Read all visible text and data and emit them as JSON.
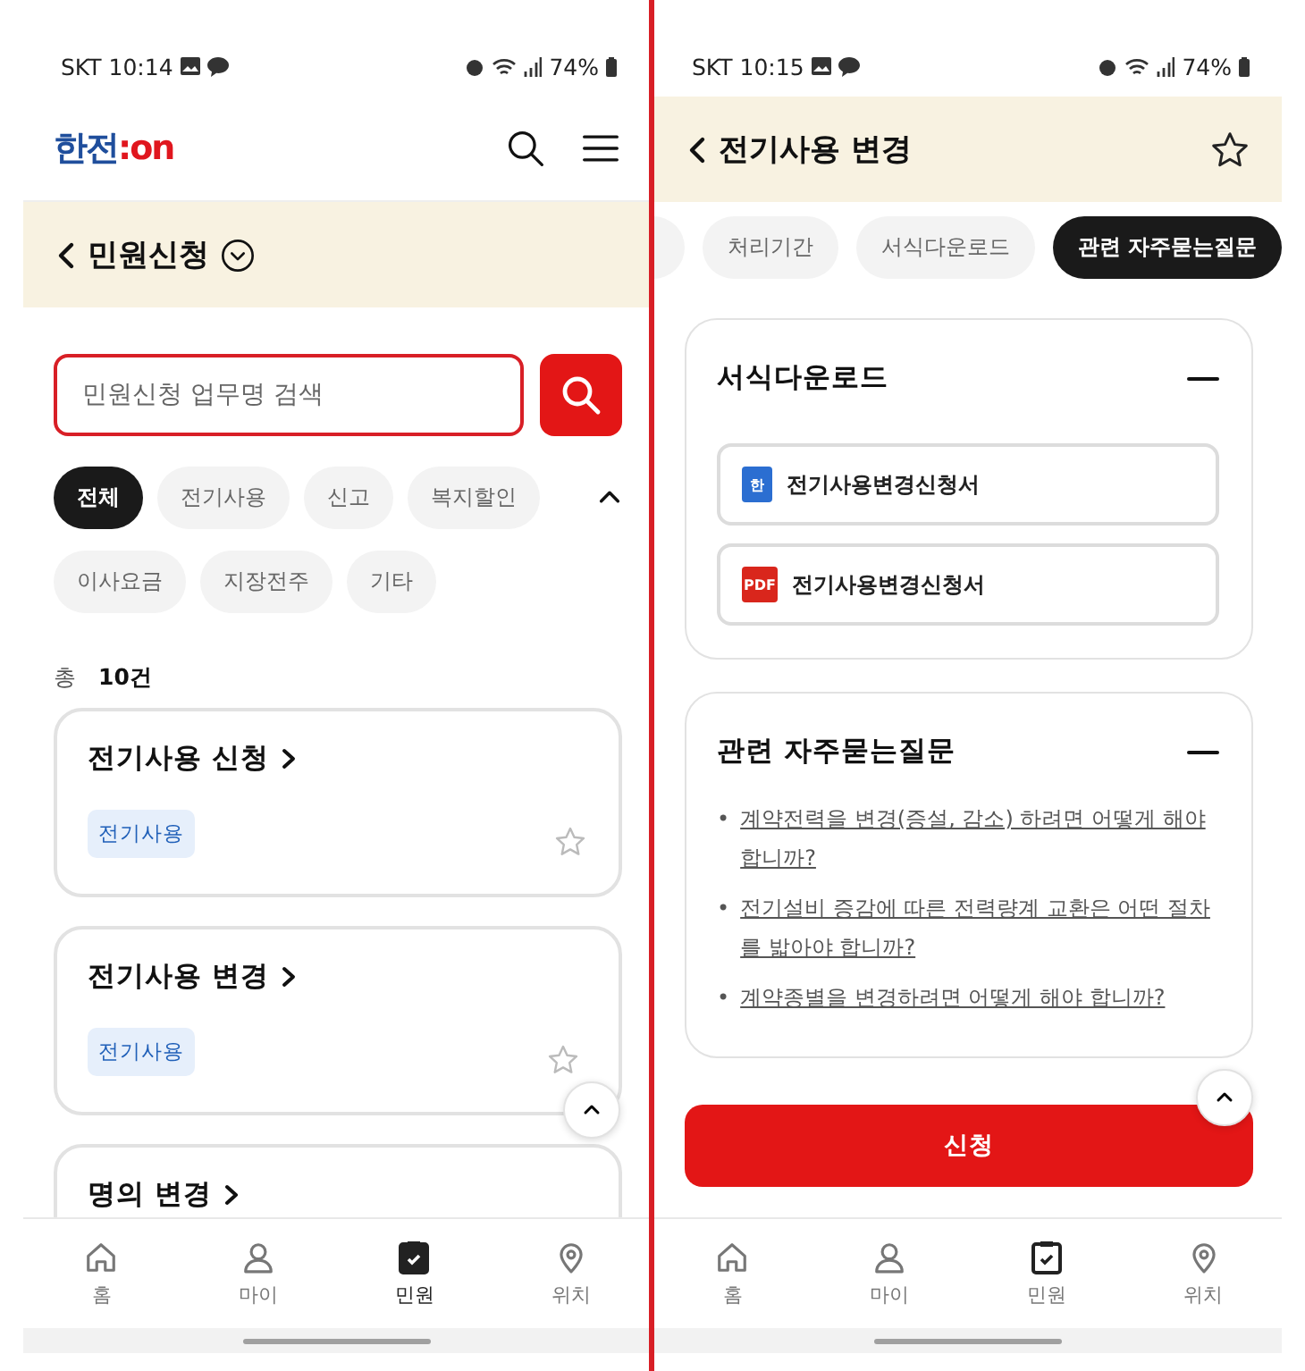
{
  "left": {
    "status": {
      "carrier_time": "SKT 10:14",
      "battery": "74%"
    },
    "logo": {
      "primary": "한전",
      "accent": ":on"
    },
    "page_title": "민원신청",
    "search": {
      "placeholder": "민원신청 업무명 검색"
    },
    "filters": [
      {
        "label": "전체",
        "selected": true
      },
      {
        "label": "전기사용",
        "selected": false
      },
      {
        "label": "신고",
        "selected": false
      },
      {
        "label": "복지할인",
        "selected": false
      },
      {
        "label": "이사요금",
        "selected": false
      },
      {
        "label": "지장전주",
        "selected": false
      },
      {
        "label": "기타",
        "selected": false
      }
    ],
    "total": {
      "label": "총",
      "count": "10건"
    },
    "cards": [
      {
        "title": "전기사용 신청",
        "tag": "전기사용",
        "favorite": false
      },
      {
        "title": "전기사용 변경",
        "tag": "전기사용",
        "favorite": false
      },
      {
        "title": "명의 변경"
      }
    ],
    "nav": [
      {
        "label": "홈",
        "kind": "home",
        "selected": false
      },
      {
        "label": "마이",
        "kind": "person",
        "selected": false
      },
      {
        "label": "민원",
        "kind": "clipboard",
        "selected": true
      },
      {
        "label": "위치",
        "kind": "pin",
        "selected": false
      }
    ]
  },
  "right": {
    "status": {
      "carrier_time": "SKT 10:15",
      "battery": "74%"
    },
    "page_title": "전기사용 변경",
    "favorite": false,
    "tabs": [
      {
        "label": "처리기간",
        "selected": false
      },
      {
        "label": "서식다운로드",
        "selected": false
      },
      {
        "label": "관련 자주묻는질문",
        "selected": true
      }
    ],
    "forms": {
      "title": "서식다운로드",
      "expanded": true,
      "files": [
        {
          "kind": "hwp",
          "badge": "한",
          "name": "전기사용변경신청서"
        },
        {
          "kind": "pdf",
          "badge": "PDF",
          "name": "전기사용변경신청서"
        }
      ]
    },
    "faq": {
      "title": "관련 자주묻는질문",
      "expanded": true,
      "bullet": "•",
      "items": [
        "계약전력을 변경(증설, 감소) 하려면 어떻게 해야 합니까?",
        "전기설비 증감에 따른 전력량계 교환은 어떤 절차를 밟아야 합니까?",
        "계약종별을 변경하려면 어떻게 해야 합니까?"
      ]
    },
    "apply_button": "신청",
    "nav": [
      {
        "label": "홈",
        "kind": "home",
        "selected": false
      },
      {
        "label": "마이",
        "kind": "person",
        "selected": false
      },
      {
        "label": "민원",
        "kind": "clipboard",
        "selected": false
      },
      {
        "label": "위치",
        "kind": "pin",
        "selected": false
      }
    ]
  }
}
